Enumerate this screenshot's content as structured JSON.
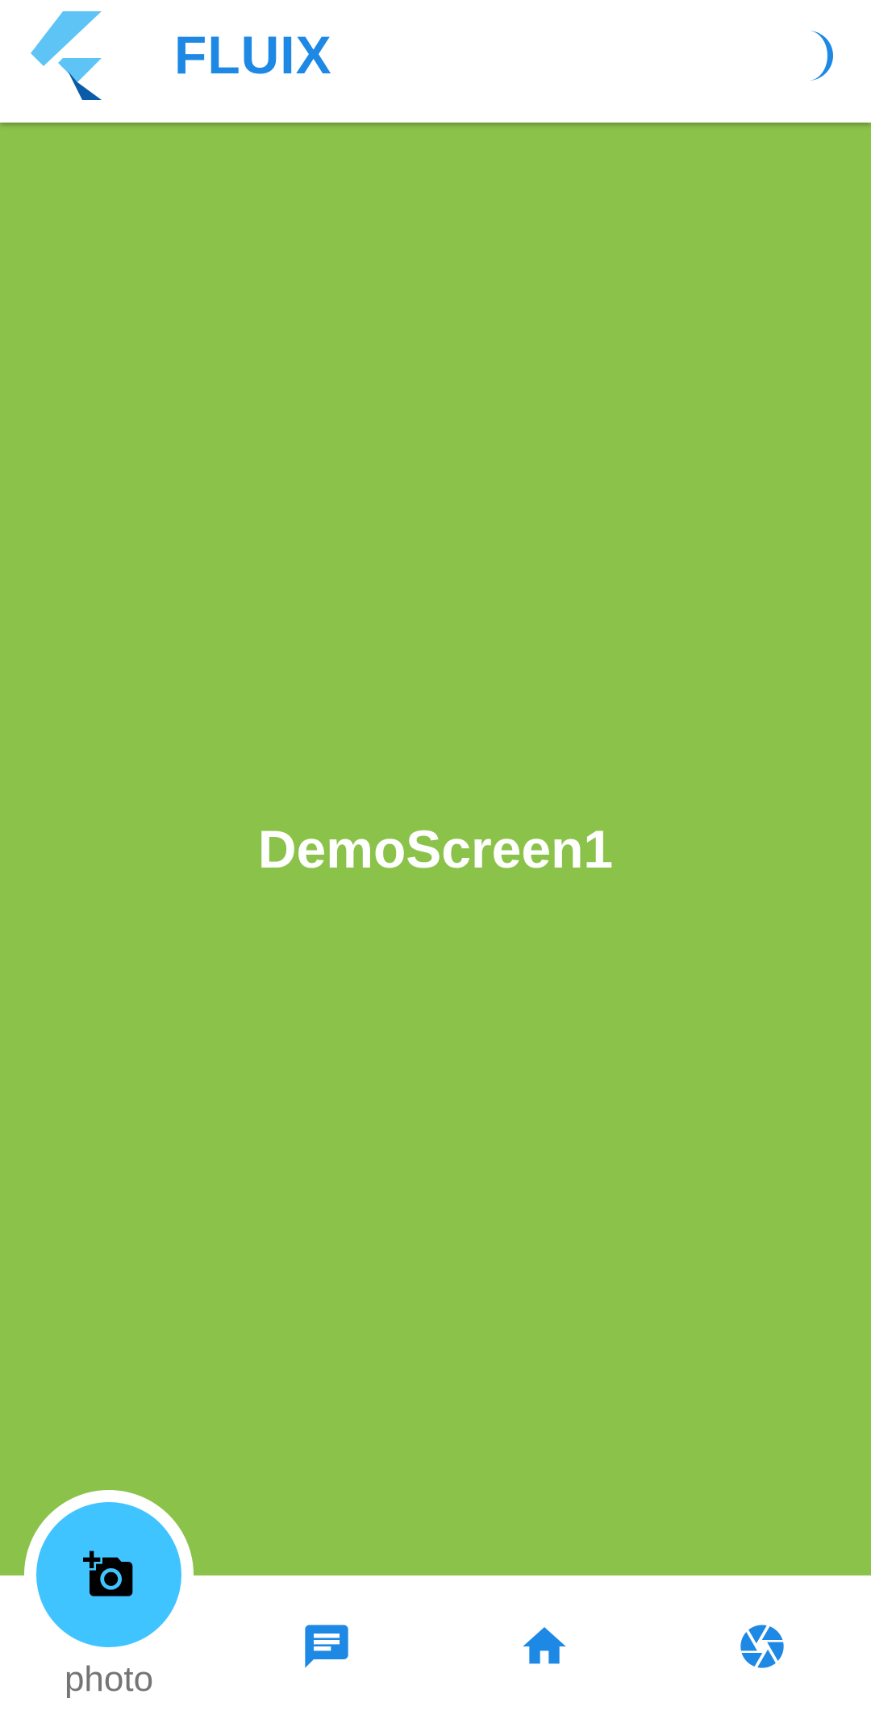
{
  "colors": {
    "accent": "#1E88E5",
    "content_background": "#8BC34A",
    "fab_background": "#40C4FF",
    "fab_icon": "#000000",
    "label_gray": "#757575",
    "logo_light": "#5EC4F5",
    "logo_dark": "#0A5CA8"
  },
  "header": {
    "logo_icon": "flutter-logo-icon",
    "title": "FLUIX",
    "theme_toggle_icon": "moon-icon"
  },
  "content": {
    "label": "DemoScreen1"
  },
  "bottom_nav": {
    "active_item": {
      "icon": "add-a-photo-icon",
      "label": "photo"
    },
    "items": [
      {
        "icon": "chat-icon"
      },
      {
        "icon": "home-icon"
      },
      {
        "icon": "camera-shutter-icon"
      }
    ]
  }
}
